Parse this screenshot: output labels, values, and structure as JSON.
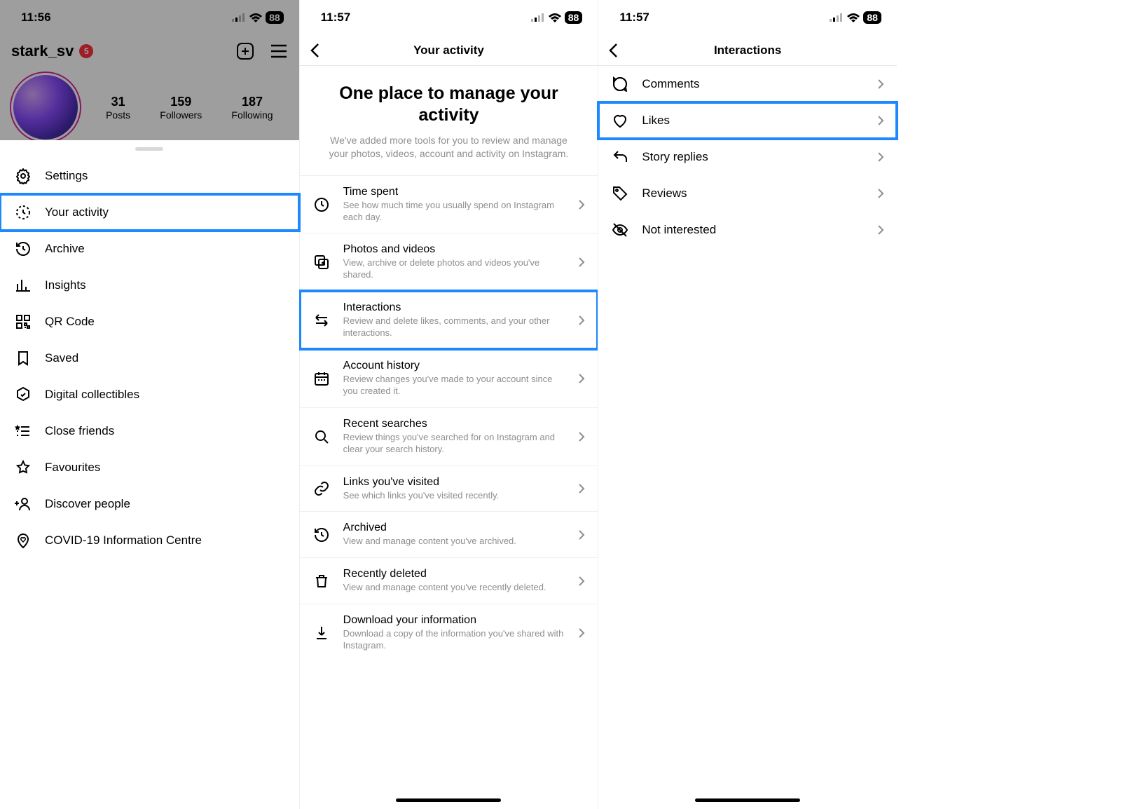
{
  "status": {
    "time1": "11:56",
    "time2": "11:57",
    "time3": "11:57",
    "battery": "88"
  },
  "profile": {
    "username": "stark_sv",
    "notif": "5",
    "posts_count": "31",
    "posts_label": "Posts",
    "followers_count": "159",
    "followers_label": "Followers",
    "following_count": "187",
    "following_label": "Following"
  },
  "menu": {
    "settings": "Settings",
    "your_activity": "Your activity",
    "archive": "Archive",
    "insights": "Insights",
    "qr_code": "QR Code",
    "saved": "Saved",
    "digital_collectibles": "Digital collectibles",
    "close_friends": "Close friends",
    "favourites": "Favourites",
    "discover_people": "Discover people",
    "covid": "COVID-19 Information Centre"
  },
  "activity": {
    "nav_title": "Your activity",
    "hero_title": "One place to manage your activity",
    "hero_sub": "We've added more tools for you to review and manage your photos, videos, account and activity on Instagram.",
    "time_spent_t": "Time spent",
    "time_spent_s": "See how much time you usually spend on Instagram each day.",
    "photos_t": "Photos and videos",
    "photos_s": "View, archive or delete photos and videos you've shared.",
    "interactions_t": "Interactions",
    "interactions_s": "Review and delete likes, comments, and your other interactions.",
    "account_t": "Account history",
    "account_s": "Review changes you've made to your account since you created it.",
    "search_t": "Recent searches",
    "search_s": "Review things you've searched for on Instagram and clear your search history.",
    "links_t": "Links you've visited",
    "links_s": "See which links you've visited recently.",
    "archived_t": "Archived",
    "archived_s": "View and manage content you've archived.",
    "deleted_t": "Recently deleted",
    "deleted_s": "View and manage content you've recently deleted.",
    "download_t": "Download your information",
    "download_s": "Download a copy of the information you've shared with Instagram."
  },
  "interactions": {
    "nav_title": "Interactions",
    "comments": "Comments",
    "likes": "Likes",
    "story_replies": "Story replies",
    "reviews": "Reviews",
    "not_interested": "Not interested"
  }
}
